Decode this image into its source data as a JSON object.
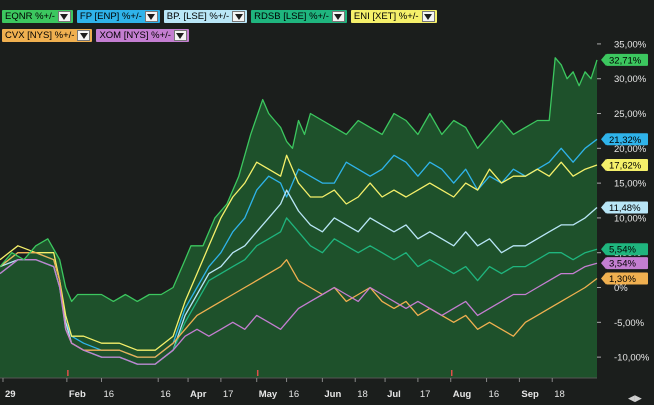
{
  "legend": {
    "row1": [
      {
        "label": "EQNR %+/-",
        "color": "#3cc75f"
      },
      {
        "label": "FP [ENP] %+/-",
        "color": "#2fb3ea"
      },
      {
        "label": "BP. [LSE] %+/-",
        "color": "#b9e6f7"
      },
      {
        "label": "RDSB [LSE] %+/-",
        "color": "#1fb57e"
      },
      {
        "label": "ENI [XET] %+/-",
        "color": "#f5f06a"
      }
    ],
    "row2": [
      {
        "label": "CVX [NYS] %+/-",
        "color": "#f0b050"
      },
      {
        "label": "XOM [NYS] %+/-",
        "color": "#c47ed1"
      }
    ]
  },
  "chart_data": {
    "type": "line",
    "ylim": [
      -13,
      37
    ],
    "yticks": [
      "35,00%",
      "30,00%",
      "25,00%",
      "20,00%",
      "15,00%",
      "10,00%",
      "5,00%",
      "0%",
      "-5,00%",
      "-10,00%"
    ],
    "ytick_values": [
      35,
      30,
      25,
      20,
      15,
      10,
      5,
      0,
      -5,
      -10
    ],
    "xlim": [
      0,
      100
    ],
    "xticks": [
      {
        "label": "29",
        "x": 0.5,
        "bold": true
      },
      {
        "label": "Feb",
        "x": 11.2,
        "bold": true
      },
      {
        "label": "16",
        "x": 17,
        "bold": false
      },
      {
        "label": "16",
        "x": 26.5,
        "bold": false
      },
      {
        "label": "Apr",
        "x": 31.5,
        "bold": true
      },
      {
        "label": "17",
        "x": 37,
        "bold": false
      },
      {
        "label": "May",
        "x": 43,
        "bold": true
      },
      {
        "label": "16",
        "x": 48,
        "bold": false
      },
      {
        "label": "Jun",
        "x": 54,
        "bold": true
      },
      {
        "label": "18",
        "x": 59.5,
        "bold": false
      },
      {
        "label": "Jul",
        "x": 64.5,
        "bold": true
      },
      {
        "label": "17",
        "x": 70,
        "bold": false
      },
      {
        "label": "Aug",
        "x": 75.5,
        "bold": true
      },
      {
        "label": "16",
        "x": 81.5,
        "bold": false
      },
      {
        "label": "Sep",
        "x": 87,
        "bold": true
      },
      {
        "label": "18",
        "x": 92.5,
        "bold": false
      }
    ],
    "series": [
      {
        "name": "EQNR %+/-",
        "color": "#3cc75f",
        "fill": true,
        "end_label": "32,71%",
        "x": [
          0,
          2,
          4,
          6,
          8,
          10,
          11,
          12,
          13,
          15,
          17,
          19,
          21,
          23,
          25,
          27,
          29,
          31,
          32,
          34,
          36,
          38,
          40,
          42,
          44,
          45,
          46,
          47,
          48,
          49,
          50,
          51,
          52,
          54,
          56,
          58,
          60,
          62,
          64,
          66,
          68,
          70,
          72,
          74,
          76,
          78,
          80,
          82,
          84,
          86,
          88,
          90,
          92,
          93,
          94,
          95,
          96,
          97,
          98,
          99,
          100
        ],
        "y": [
          3,
          5,
          4,
          6,
          7,
          4,
          0,
          -2,
          -1,
          -1,
          -1,
          -2,
          -1,
          -2,
          -1,
          -1,
          0,
          4,
          6,
          6,
          10,
          12,
          16,
          22,
          27,
          25,
          24,
          23,
          21,
          20,
          24,
          22,
          25,
          24,
          23,
          22,
          24,
          23,
          22,
          25,
          24,
          22,
          25,
          22,
          24,
          23,
          20,
          22,
          24,
          22,
          23,
          24,
          24,
          33,
          32,
          30,
          31,
          29,
          31,
          30,
          32.7
        ]
      },
      {
        "name": "FP [ENP] %+/-",
        "color": "#2fb3ea",
        "end_label": "21,32%",
        "x": [
          0,
          3,
          6,
          9,
          10,
          11,
          12,
          14,
          17,
          20,
          23,
          26,
          29,
          31,
          33,
          35,
          37,
          39,
          41,
          43,
          45,
          47,
          48,
          50,
          52,
          54,
          56,
          58,
          60,
          62,
          64,
          66,
          68,
          70,
          72,
          74,
          76,
          78,
          80,
          82,
          84,
          86,
          88,
          90,
          92,
          94,
          96,
          98,
          100
        ],
        "y": [
          3,
          5,
          5,
          4,
          1,
          -5,
          -7,
          -8,
          -9,
          -9,
          -10,
          -10,
          -8,
          -3,
          0,
          3,
          5,
          8,
          10,
          14,
          16,
          15,
          13,
          17,
          16,
          15,
          15,
          18,
          17,
          16,
          17,
          19,
          18,
          16,
          18,
          17,
          15,
          17,
          14,
          16,
          15,
          17,
          16,
          17,
          18,
          20,
          18,
          20,
          21.3
        ]
      },
      {
        "name": "BP. [LSE] %+/-",
        "color": "#b9e6f7",
        "end_label": "11,48%",
        "x": [
          0,
          3,
          6,
          9,
          10,
          11,
          12,
          14,
          17,
          20,
          23,
          26,
          29,
          31,
          33,
          35,
          37,
          39,
          41,
          43,
          45,
          47,
          48,
          50,
          52,
          54,
          56,
          58,
          60,
          62,
          64,
          66,
          68,
          70,
          72,
          74,
          76,
          78,
          80,
          82,
          84,
          86,
          88,
          90,
          92,
          94,
          96,
          98,
          100
        ],
        "y": [
          3,
          4,
          4,
          3,
          0,
          -5,
          -8,
          -9,
          -10,
          -10,
          -11,
          -11,
          -9,
          -4,
          -1,
          2,
          3,
          5,
          6,
          8,
          10,
          12,
          14,
          11,
          9,
          8,
          10,
          9,
          8,
          10,
          9,
          8,
          9,
          7,
          8,
          7,
          6,
          8,
          6,
          7,
          5,
          6,
          6,
          7,
          8,
          9,
          9,
          10,
          11.5
        ]
      },
      {
        "name": "RDSB [LSE] %+/-",
        "color": "#1fb57e",
        "end_label": "5,54%",
        "x": [
          0,
          3,
          6,
          9,
          10,
          11,
          12,
          14,
          17,
          20,
          23,
          26,
          29,
          31,
          33,
          35,
          37,
          39,
          41,
          43,
          45,
          47,
          48,
          50,
          52,
          54,
          56,
          58,
          60,
          62,
          64,
          66,
          68,
          70,
          72,
          74,
          76,
          78,
          80,
          82,
          84,
          86,
          88,
          90,
          92,
          94,
          96,
          98,
          100
        ],
        "y": [
          2,
          4,
          4,
          3,
          0,
          -6,
          -8,
          -9,
          -10,
          -10,
          -11,
          -11,
          -9,
          -5,
          -2,
          1,
          2,
          3,
          4,
          6,
          7,
          8,
          10,
          8,
          6,
          5,
          7,
          6,
          5,
          6,
          5,
          4,
          5,
          3,
          4,
          3,
          2,
          3,
          1,
          3,
          2,
          3,
          3,
          4,
          5,
          5,
          4,
          5,
          5.5
        ]
      },
      {
        "name": "ENI [XET] %+/-",
        "color": "#f5f06a",
        "end_label": "17,62%",
        "x": [
          0,
          3,
          6,
          9,
          10,
          11,
          12,
          14,
          17,
          20,
          23,
          26,
          29,
          31,
          33,
          35,
          37,
          39,
          41,
          43,
          45,
          47,
          48,
          50,
          52,
          54,
          56,
          58,
          60,
          62,
          64,
          66,
          68,
          70,
          72,
          74,
          76,
          78,
          80,
          82,
          84,
          86,
          88,
          90,
          92,
          94,
          96,
          98,
          100
        ],
        "y": [
          4,
          6,
          5,
          5,
          1,
          -4,
          -7,
          -7,
          -8,
          -8,
          -9,
          -9,
          -7,
          -2,
          2,
          6,
          10,
          13,
          15,
          18,
          17,
          16,
          19,
          15,
          13,
          13,
          14,
          12,
          13,
          15,
          13,
          14,
          13,
          14,
          15,
          14,
          13,
          15,
          14,
          17,
          15,
          16,
          16,
          17,
          16,
          18,
          16,
          17,
          17.6
        ]
      },
      {
        "name": "CVX [NYS] %+/-",
        "color": "#f0b050",
        "end_label": "1,30%",
        "x": [
          0,
          3,
          6,
          9,
          10,
          11,
          12,
          14,
          17,
          20,
          23,
          26,
          29,
          31,
          33,
          35,
          37,
          39,
          41,
          43,
          45,
          47,
          48,
          50,
          52,
          54,
          56,
          58,
          60,
          62,
          64,
          66,
          68,
          70,
          72,
          74,
          76,
          78,
          80,
          82,
          84,
          86,
          88,
          90,
          92,
          94,
          96,
          98,
          100
        ],
        "y": [
          3,
          5,
          5,
          4,
          1,
          -6,
          -8,
          -9,
          -9,
          -9,
          -10,
          -10,
          -8,
          -6,
          -4,
          -3,
          -2,
          -1,
          0,
          1,
          2,
          3,
          4,
          1,
          0,
          -1,
          0,
          -2,
          -1,
          0,
          -2,
          -3,
          -2,
          -4,
          -3,
          -4,
          -5,
          -4,
          -6,
          -5,
          -6,
          -7,
          -5,
          -4,
          -3,
          -2,
          -1,
          0,
          1.3
        ]
      },
      {
        "name": "XOM [NYS] %+/-",
        "color": "#c47ed1",
        "end_label": "3,54%",
        "x": [
          0,
          3,
          6,
          9,
          10,
          11,
          12,
          14,
          17,
          20,
          23,
          26,
          29,
          31,
          33,
          35,
          37,
          39,
          41,
          43,
          45,
          47,
          48,
          50,
          52,
          54,
          56,
          58,
          60,
          62,
          64,
          66,
          68,
          70,
          72,
          74,
          76,
          78,
          80,
          82,
          84,
          86,
          88,
          90,
          92,
          94,
          96,
          98,
          100
        ],
        "y": [
          2,
          4,
          4,
          3,
          0,
          -6,
          -8,
          -9,
          -10,
          -10,
          -11,
          -11,
          -9,
          -7,
          -6,
          -7,
          -6,
          -5,
          -6,
          -4,
          -5,
          -6,
          -5,
          -3,
          -2,
          -1,
          0,
          -1,
          -2,
          0,
          -1,
          -2,
          -3,
          -2,
          -3,
          -4,
          -3,
          -2,
          -4,
          -3,
          -2,
          -1,
          -1,
          0,
          1,
          2,
          2,
          3,
          3.5
        ]
      }
    ]
  }
}
